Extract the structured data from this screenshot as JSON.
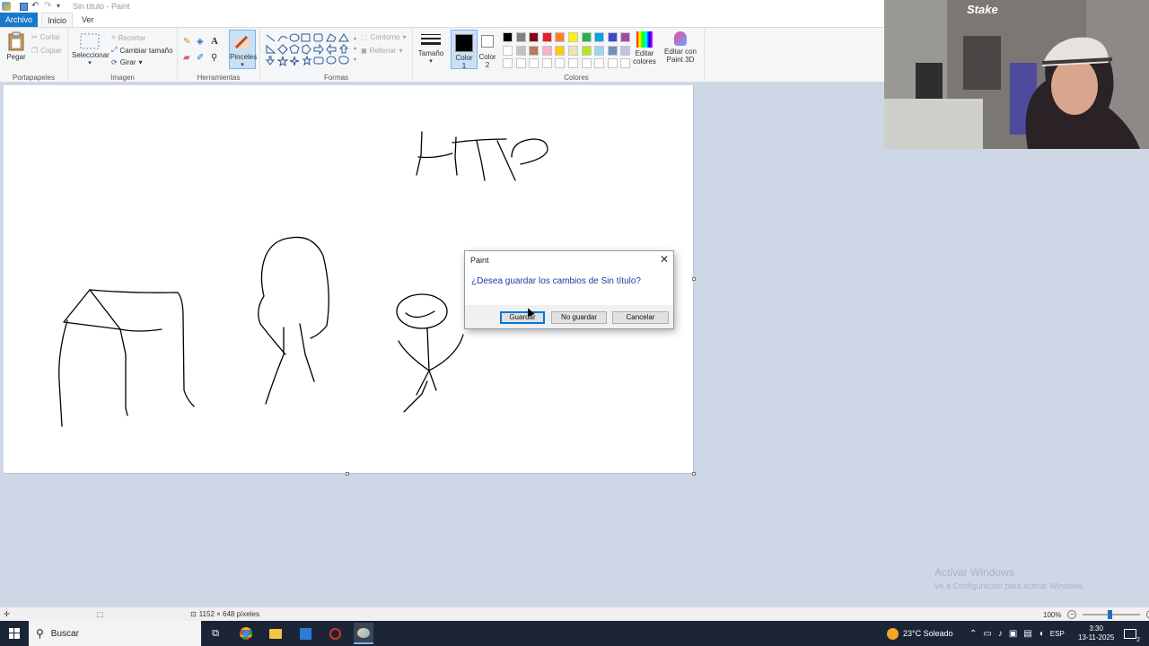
{
  "window": {
    "title": "Sin título - Paint"
  },
  "tabs": {
    "file": "Archivo",
    "home": "Inicio",
    "view": "Ver"
  },
  "ribbon": {
    "clipboard": {
      "paste": "Pegar",
      "cut": "Cortar",
      "copy": "Copiar",
      "label": "Portapapeles"
    },
    "image": {
      "select": "Seleccionar",
      "crop": "Recortar",
      "resize": "Cambiar tamaño",
      "rotate": "Girar",
      "label": "Imagen"
    },
    "tools": {
      "label": "Herramientas",
      "brushes": "Pinceles"
    },
    "shapes": {
      "outline": "Contorno",
      "fill": "Rellenar",
      "label": "Formas"
    },
    "size": {
      "label": "Tamaño"
    },
    "colors": {
      "color1": "Color 1",
      "color2": "Color 2",
      "edit": "Editar colores",
      "paint3d": "Editar con Paint 3D",
      "label": "Colores",
      "color1_value": "#000000",
      "color2_value": "#ffffff",
      "palette_row1": [
        "#000000",
        "#7f7f7f",
        "#880015",
        "#ed1c24",
        "#ff7f27",
        "#fff200",
        "#22b14c",
        "#00a2e8",
        "#3f48cc",
        "#a349a4"
      ],
      "palette_row2": [
        "#ffffff",
        "#c3c3c3",
        "#b97a57",
        "#ffaec9",
        "#ffc90e",
        "#efe4b0",
        "#b5e61d",
        "#99d9ea",
        "#7092be",
        "#c8bfe7"
      ]
    }
  },
  "dialog": {
    "title": "Paint",
    "message": "¿Desea guardar los cambios de Sin título?",
    "save": "Guardar",
    "dont_save": "No guardar",
    "cancel": "Cancelar"
  },
  "statusbar": {
    "dimensions": "1152 × 648 píxeles",
    "zoom": "100%"
  },
  "watermark": {
    "line1": "Activar Windows",
    "line2": "Ve a Configuración para activar Windows."
  },
  "webcam": {
    "logo": "Stake"
  },
  "taskbar": {
    "search": "Buscar",
    "weather": "23°C  Soleado",
    "language": "ESP",
    "time": "3:30",
    "date": "13-11-2025",
    "notifications": "2"
  }
}
